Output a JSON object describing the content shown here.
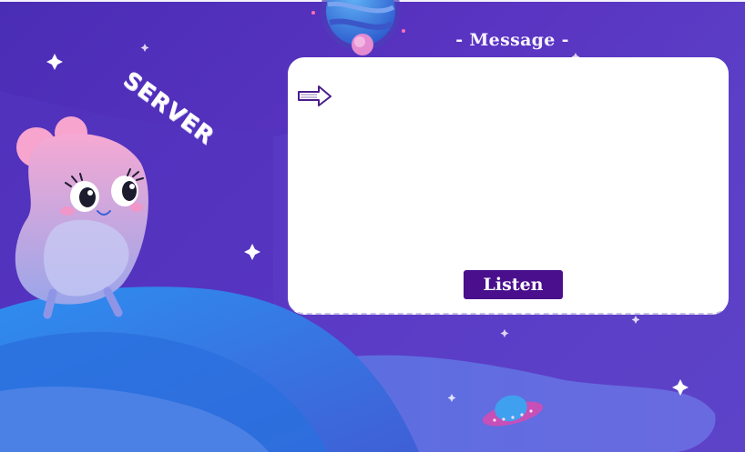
{
  "message_panel": {
    "title": "- Message -",
    "arrow_icon": "hand-drawn-arrow-icon",
    "listen_label": "Listen"
  },
  "character": {
    "label": "SERVER"
  },
  "colors": {
    "background": "#5a34c2",
    "card": "#ffffff",
    "button": "#4a0f8c",
    "character_pink": "#f6a9d3",
    "planet_blue": "#2f7fe0"
  }
}
